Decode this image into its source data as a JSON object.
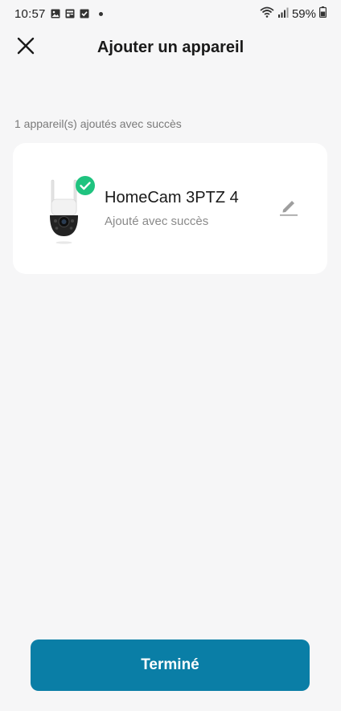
{
  "status_bar": {
    "time": "10:57",
    "battery": "59%",
    "icons": [
      "gallery-icon",
      "card-icon",
      "checkbox-icon",
      "dot-icon",
      "wifi-icon",
      "signal-icon",
      "battery-icon"
    ]
  },
  "header": {
    "title": "Ajouter un appareil",
    "close_icon": "close-icon"
  },
  "result": {
    "count_text": "1 appareil(s) ajoutés avec succès"
  },
  "device": {
    "name": "HomeCam 3PTZ 4",
    "status": "Ajouté avec succès",
    "image_icon": "ptz-camera-icon",
    "badge_icon": "check-circle-icon",
    "edit_icon": "pencil-icon"
  },
  "footer": {
    "done_label": "Terminé"
  },
  "colors": {
    "accent": "#0a7ea6",
    "success": "#1fc37f",
    "background": "#f6f6f7",
    "card": "#ffffff"
  }
}
